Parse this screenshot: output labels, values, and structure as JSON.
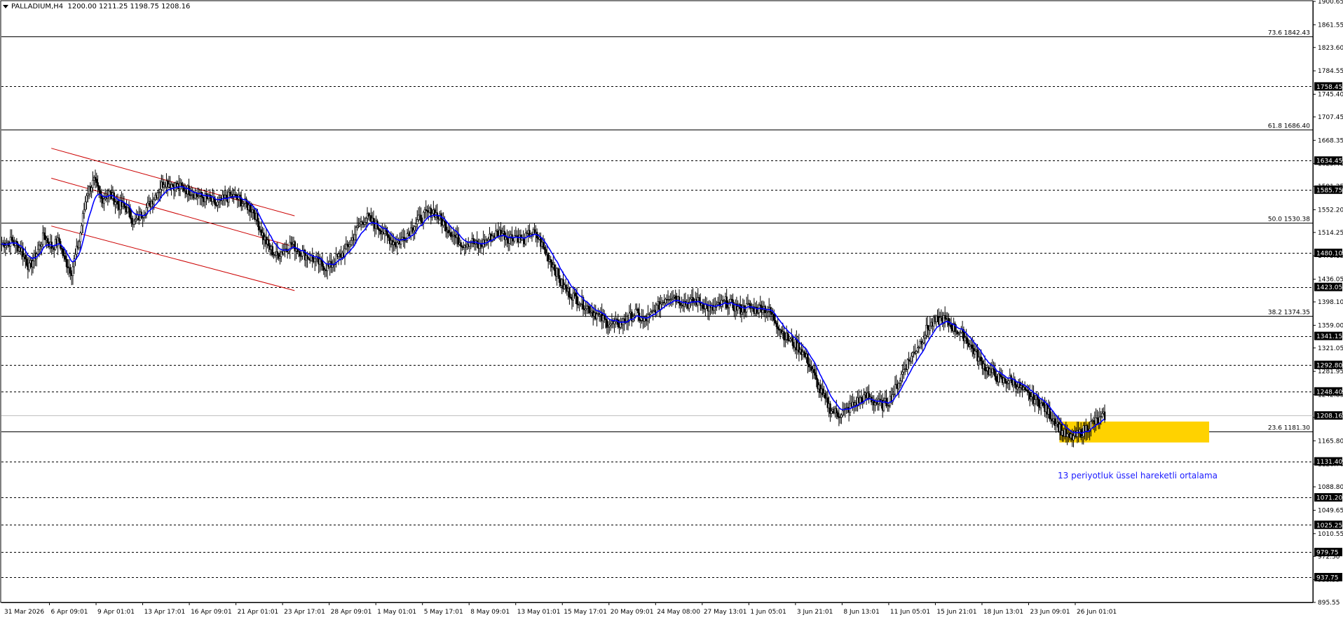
{
  "header": {
    "symbol": "PALLADIUM,H4",
    "ohlc": "1200.00 1211.25 1198.75 1208.16"
  },
  "annotation": {
    "ema_label": "13 periyotluk üssel hareketli ortalama"
  },
  "colors": {
    "candle": "#000000",
    "ema": "#0000ff",
    "channel": "#cc0000",
    "zone": "#ffd200",
    "level_line": "#000000",
    "grid_bg": "#ffffff"
  },
  "chart_data": {
    "type": "candlestick",
    "ylim": [
      895.55,
      1900.65
    ],
    "price_axis_ticks": [
      "1900.65",
      "1861.55",
      "1823.60",
      "1784.55",
      "1745.40",
      "1707.45",
      "1668.35",
      "1629.40",
      "1591.25",
      "1552.20",
      "1514.25",
      "1475.15",
      "1436.05",
      "1398.10",
      "1359.00",
      "1321.05",
      "1281.95",
      "1242.85",
      "1204.90",
      "1165.80",
      "1126.70",
      "1088.80",
      "1049.65",
      "1010.55",
      "972.50",
      "933.55",
      "895.55"
    ],
    "time_axis_labels": [
      "31 Mar 2026",
      "6 Apr 09:01",
      "9 Apr 01:01",
      "13 Apr 17:01",
      "16 Apr 09:01",
      "21 Apr 01:01",
      "23 Apr 17:01",
      "28 Apr 09:01",
      "1 May 01:01",
      "5 May 17:01",
      "8 May 09:01",
      "13 May 01:01",
      "15 May 17:01",
      "20 May 09:01",
      "24 May 08:00",
      "27 May 13:01",
      "1 Jun 05:01",
      "3 Jun 21:01",
      "8 Jun 13:01",
      "11 Jun 05:01",
      "15 Jun 21:01",
      "18 Jun 13:01",
      "23 Jun 09:01",
      "26 Jun 01:01"
    ],
    "fib_levels": [
      {
        "label": "73.6 1842.43",
        "value": 1842.43
      },
      {
        "label": "61.8 1686.40",
        "value": 1686.4
      },
      {
        "label": "50.0 1530.38",
        "value": 1530.38
      },
      {
        "label": "38.2 1374.35",
        "value": 1374.35
      },
      {
        "label": "23.6 1181.30",
        "value": 1181.3
      }
    ],
    "horizontal_levels": [
      {
        "label": "1758.45",
        "value": 1758.45
      },
      {
        "label": "1634.45",
        "value": 1634.45
      },
      {
        "label": "1585.75",
        "value": 1585.75
      },
      {
        "label": "1480.10",
        "value": 1480.1
      },
      {
        "label": "1423.05",
        "value": 1423.05
      },
      {
        "label": "1341.15",
        "value": 1341.15
      },
      {
        "label": "1292.80",
        "value": 1292.8
      },
      {
        "label": "1248.40",
        "value": 1248.4
      },
      {
        "label": "1131.40",
        "value": 1131.4
      },
      {
        "label": "1071.20",
        "value": 1071.2
      },
      {
        "label": "1025.25",
        "value": 1025.25
      },
      {
        "label": "979.75",
        "value": 979.75
      },
      {
        "label": "937.75",
        "value": 937.75
      }
    ],
    "current_price": {
      "label": "1208.16",
      "value": 1208.16
    },
    "price_path": [
      [
        0,
        1495
      ],
      [
        8,
        1500
      ],
      [
        16,
        1485
      ],
      [
        22,
        1455
      ],
      [
        28,
        1480
      ],
      [
        34,
        1510
      ],
      [
        40,
        1490
      ],
      [
        46,
        1500
      ],
      [
        50,
        1470
      ],
      [
        56,
        1450
      ],
      [
        62,
        1500
      ],
      [
        68,
        1580
      ],
      [
        74,
        1600
      ],
      [
        80,
        1570
      ],
      [
        86,
        1580
      ],
      [
        94,
        1560
      ],
      [
        100,
        1555
      ],
      [
        106,
        1530
      ],
      [
        112,
        1545
      ],
      [
        118,
        1560
      ],
      [
        124,
        1580
      ],
      [
        130,
        1600
      ],
      [
        136,
        1595
      ],
      [
        142,
        1590
      ],
      [
        150,
        1585
      ],
      [
        158,
        1575
      ],
      [
        166,
        1570
      ],
      [
        172,
        1560
      ],
      [
        178,
        1570
      ],
      [
        184,
        1575
      ],
      [
        190,
        1570
      ],
      [
        196,
        1560
      ],
      [
        202,
        1550
      ],
      [
        208,
        1515
      ],
      [
        214,
        1490
      ],
      [
        220,
        1475
      ],
      [
        226,
        1485
      ],
      [
        232,
        1495
      ],
      [
        238,
        1485
      ],
      [
        244,
        1475
      ],
      [
        250,
        1470
      ],
      [
        256,
        1460
      ],
      [
        262,
        1455
      ],
      [
        268,
        1470
      ],
      [
        274,
        1480
      ],
      [
        280,
        1500
      ],
      [
        286,
        1525
      ],
      [
        292,
        1540
      ],
      [
        298,
        1530
      ],
      [
        304,
        1520
      ],
      [
        310,
        1505
      ],
      [
        316,
        1495
      ],
      [
        322,
        1505
      ],
      [
        328,
        1520
      ],
      [
        334,
        1535
      ],
      [
        340,
        1545
      ],
      [
        346,
        1550
      ],
      [
        352,
        1535
      ],
      [
        358,
        1520
      ],
      [
        364,
        1505
      ],
      [
        370,
        1495
      ],
      [
        376,
        1500
      ],
      [
        382,
        1490
      ],
      [
        388,
        1500
      ],
      [
        394,
        1510
      ],
      [
        400,
        1515
      ],
      [
        406,
        1505
      ],
      [
        412,
        1510
      ],
      [
        418,
        1500
      ],
      [
        424,
        1515
      ],
      [
        430,
        1505
      ],
      [
        436,
        1480
      ],
      [
        442,
        1460
      ],
      [
        448,
        1430
      ],
      [
        454,
        1415
      ],
      [
        460,
        1405
      ],
      [
        466,
        1395
      ],
      [
        472,
        1385
      ],
      [
        478,
        1375
      ],
      [
        484,
        1365
      ],
      [
        490,
        1360
      ],
      [
        496,
        1362
      ],
      [
        502,
        1370
      ],
      [
        508,
        1380
      ],
      [
        514,
        1365
      ],
      [
        520,
        1375
      ],
      [
        526,
        1390
      ],
      [
        532,
        1405
      ],
      [
        538,
        1410
      ],
      [
        544,
        1400
      ],
      [
        550,
        1395
      ],
      [
        556,
        1400
      ],
      [
        562,
        1395
      ],
      [
        568,
        1385
      ],
      [
        574,
        1390
      ],
      [
        580,
        1398
      ],
      [
        586,
        1392
      ],
      [
        592,
        1385
      ],
      [
        598,
        1390
      ],
      [
        604,
        1385
      ],
      [
        610,
        1390
      ],
      [
        616,
        1380
      ],
      [
        622,
        1360
      ],
      [
        628,
        1340
      ],
      [
        634,
        1330
      ],
      [
        640,
        1320
      ],
      [
        646,
        1300
      ],
      [
        652,
        1270
      ],
      [
        658,
        1240
      ],
      [
        664,
        1220
      ],
      [
        670,
        1210
      ],
      [
        676,
        1215
      ],
      [
        682,
        1225
      ],
      [
        688,
        1235
      ],
      [
        694,
        1240
      ],
      [
        700,
        1230
      ],
      [
        706,
        1225
      ],
      [
        712,
        1235
      ],
      [
        718,
        1260
      ],
      [
        724,
        1290
      ],
      [
        730,
        1310
      ],
      [
        736,
        1330
      ],
      [
        742,
        1355
      ],
      [
        748,
        1365
      ],
      [
        754,
        1370
      ],
      [
        760,
        1360
      ],
      [
        766,
        1350
      ],
      [
        772,
        1340
      ],
      [
        778,
        1320
      ],
      [
        784,
        1300
      ],
      [
        790,
        1285
      ],
      [
        796,
        1275
      ],
      [
        802,
        1265
      ],
      [
        808,
        1268
      ],
      [
        814,
        1260
      ],
      [
        820,
        1245
      ],
      [
        826,
        1238
      ],
      [
        832,
        1230
      ],
      [
        838,
        1215
      ],
      [
        844,
        1200
      ],
      [
        850,
        1180
      ],
      [
        856,
        1170
      ],
      [
        862,
        1175
      ],
      [
        868,
        1185
      ],
      [
        874,
        1195
      ],
      [
        880,
        1200
      ],
      [
        884,
        1208
      ]
    ],
    "ema_period": 13,
    "channel": {
      "upper": [
        [
          40,
          1655
        ],
        [
          235,
          1542
        ]
      ],
      "middle": [
        [
          40,
          1605
        ],
        [
          235,
          1490
        ]
      ],
      "lower": [
        [
          40,
          1525
        ],
        [
          235,
          1417
        ]
      ]
    },
    "zone": {
      "x0": 848,
      "x1": 968,
      "y_high": 1198,
      "y_low": 1163
    }
  }
}
